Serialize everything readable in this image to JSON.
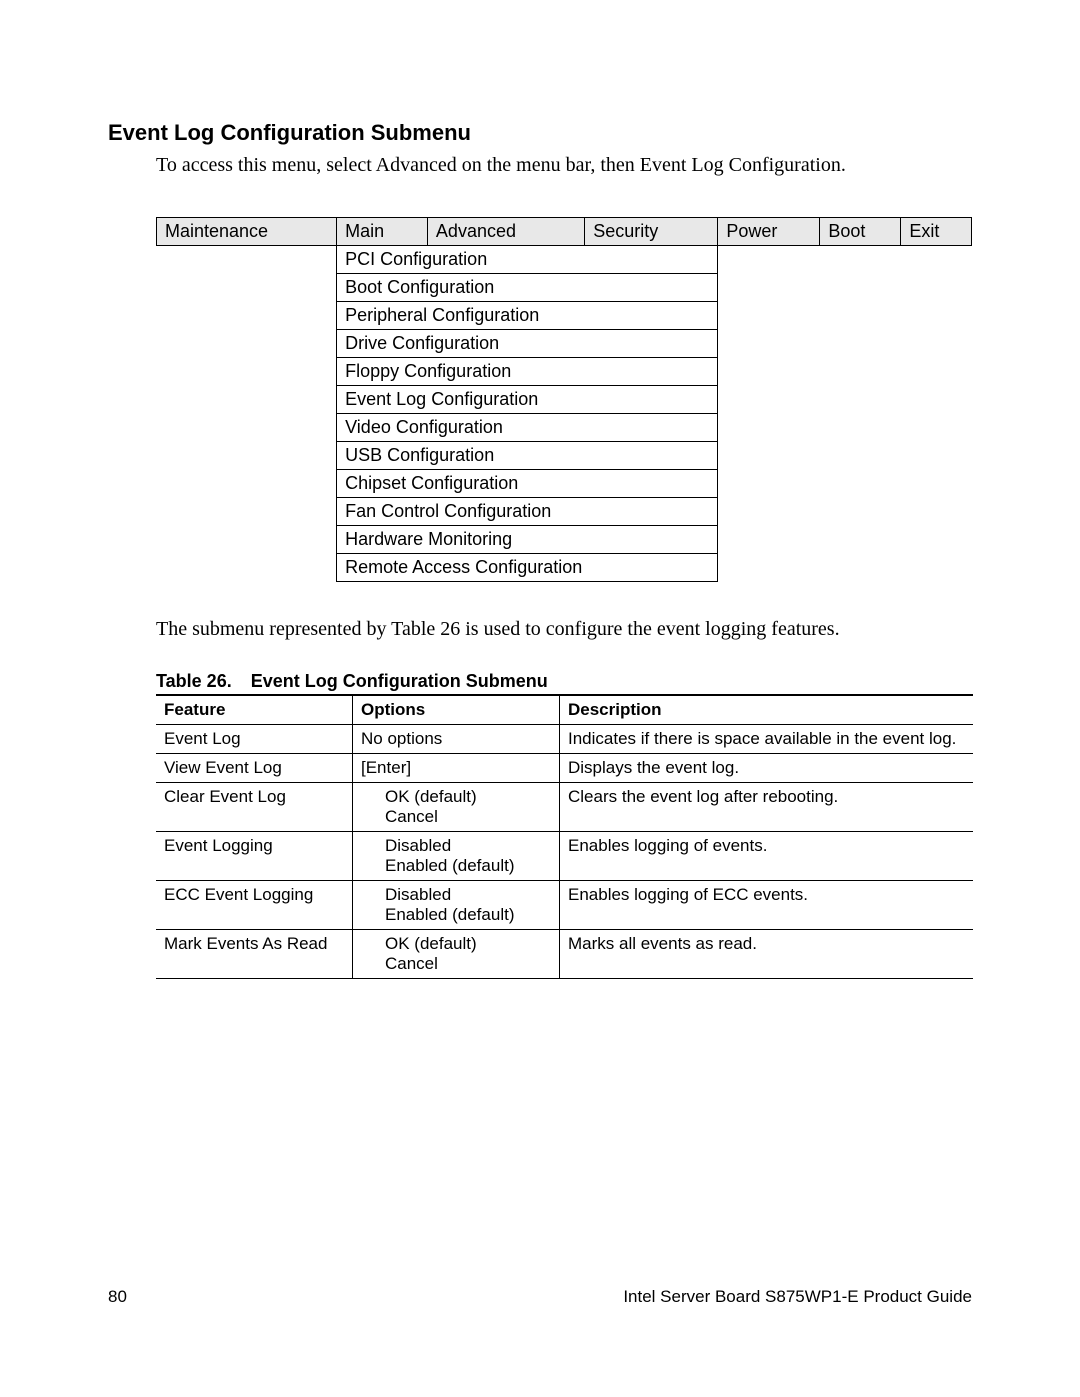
{
  "heading": "Event Log Configuration Submenu",
  "intro": "To access this menu, select Advanced on the menu bar, then Event Log Configuration.",
  "menu_bar": [
    "Maintenance",
    "Main",
    "Advanced",
    "Security",
    "Power",
    "Boot",
    "Exit"
  ],
  "submenu_items": [
    "PCI Configuration",
    "Boot Configuration",
    "Peripheral Configuration",
    "Drive Configuration",
    "Floppy Configuration",
    "Event Log Configuration",
    "Video Configuration",
    "USB Configuration",
    "Chipset Configuration",
    "Fan Control Configuration",
    "Hardware Monitoring",
    "Remote Access Configuration"
  ],
  "submenu_indented_index": 5,
  "mid_paragraph": "The submenu represented by Table 26 is used to configure the event logging features.",
  "table_caption_num": "Table 26.",
  "table_caption_text": "Event Log Configuration Submenu",
  "table_headers": {
    "feature": "Feature",
    "options": "Options",
    "description": "Description"
  },
  "rows": [
    {
      "feature": "Event Log",
      "options": [
        "No options"
      ],
      "indent": false,
      "description": "Indicates if there is space available in the event log."
    },
    {
      "feature": "View Event Log",
      "options": [
        "[Enter]"
      ],
      "indent": false,
      "description": "Displays the event log."
    },
    {
      "feature": "Clear Event Log",
      "options": [
        "OK (default)",
        "Cancel"
      ],
      "indent": true,
      "description": "Clears the event log after rebooting."
    },
    {
      "feature": "Event Logging",
      "options": [
        "Disabled",
        "Enabled (default)"
      ],
      "indent": true,
      "description": "Enables logging of events."
    },
    {
      "feature": "ECC Event Logging",
      "options": [
        "Disabled",
        "Enabled (default)"
      ],
      "indent": true,
      "description": "Enables logging of ECC events."
    },
    {
      "feature": "Mark Events As Read",
      "options": [
        "OK (default)",
        "Cancel"
      ],
      "indent": true,
      "description": "Marks all events as read."
    }
  ],
  "footer": {
    "page_number": "80",
    "doc_title": "Intel Server Board S875WP1-E Product Guide"
  }
}
